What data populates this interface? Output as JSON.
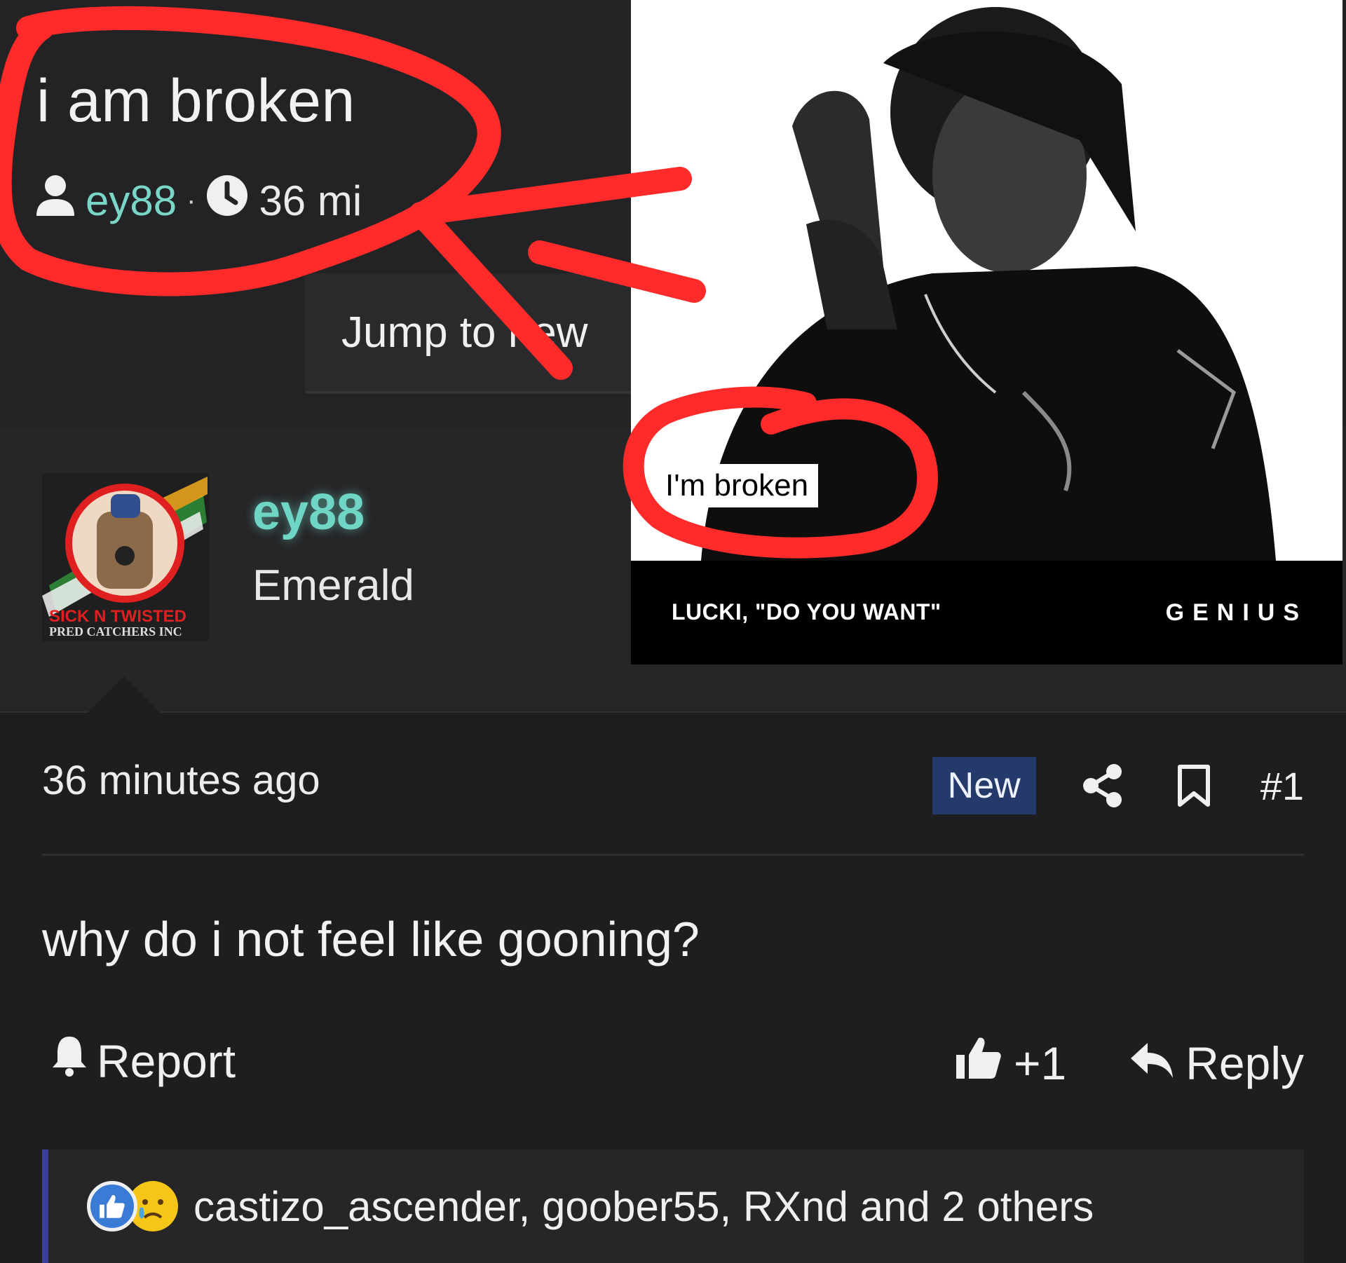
{
  "thread": {
    "title": "i am broken",
    "author": "ey88",
    "separator": "·",
    "time": "36 mi",
    "jump_label": "Jump to new"
  },
  "post": {
    "username": "ey88",
    "rank": "Emerald",
    "avatar_text": {
      "line1": "SICK N TWISTED",
      "line2": "PRED CATCHERS INC"
    },
    "time": "36 minutes ago",
    "badge": "New",
    "number": "#1",
    "body": "why do i not feel like gooning?",
    "report_label": "Report",
    "like_count": "+1",
    "reply_label": "Reply",
    "reactions_text": "castizo_ascender, goober55, RXnd and 2 others"
  },
  "genius_card": {
    "lyric": "I'm broken",
    "caption": "LUCKI, \"DO YOU WANT\"",
    "logo": "GENIUS"
  },
  "icons": [
    "user-icon",
    "clock-icon",
    "share-icon",
    "bookmark-icon",
    "bell-icon",
    "thumbs-up-icon",
    "reply-icon",
    "like-reaction-icon",
    "sad-reaction-icon"
  ],
  "colors": {
    "accent_username": "#6fd6c6",
    "new_badge_bg": "#233a6b",
    "scribble_red": "#ff2b2b",
    "background": "#1e1e20"
  }
}
